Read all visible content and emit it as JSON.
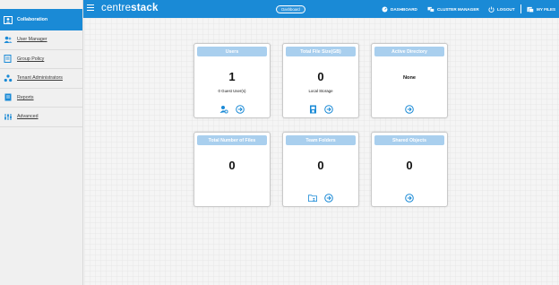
{
  "app": {
    "logo_light": "centre",
    "logo_bold": "stack",
    "dashboard_pill": "Dashboard"
  },
  "header_nav": [
    {
      "label": "DASHBOARD",
      "icon": "dashboard-icon"
    },
    {
      "label": "CLUSTER MANAGER",
      "icon": "cluster-manager-icon"
    },
    {
      "label": "LOGOUT",
      "icon": "logout-icon"
    },
    {
      "label": "MY FILES",
      "icon": "my-files-icon"
    }
  ],
  "sidebar": {
    "items": [
      {
        "label": "Collaboration",
        "icon": "collaboration-icon",
        "active": true
      },
      {
        "label": "User Manager",
        "icon": "user-manager-icon"
      },
      {
        "label": "Group Policy",
        "icon": "group-policy-icon"
      },
      {
        "label": "Tenant Administrators",
        "icon": "tenant-administrators-icon"
      },
      {
        "label": "Reports",
        "icon": "reports-icon"
      },
      {
        "label": "Advanced",
        "icon": "advanced-icon"
      }
    ]
  },
  "cards": [
    {
      "title": "Users",
      "value": "1",
      "sub": "0 Guest User(s)",
      "icons": [
        "user-settings-icon",
        "arrow-right-circle-icon"
      ]
    },
    {
      "title": "Total File Size(GB)",
      "value": "0",
      "sub": "Local Storage",
      "icons": [
        "storage-icon",
        "arrow-right-circle-icon"
      ]
    },
    {
      "title": "Active Directory",
      "value": "None",
      "sub": "",
      "icons": [
        "arrow-right-circle-icon"
      ]
    },
    {
      "title": "Total Number of Files",
      "value": "0",
      "sub": "",
      "icons": []
    },
    {
      "title": "Team Folders",
      "value": "0",
      "sub": "",
      "icons": [
        "team-folder-icon",
        "arrow-right-circle-icon"
      ]
    },
    {
      "title": "Shared Objects",
      "value": "0",
      "sub": "",
      "icons": [
        "arrow-right-circle-icon"
      ]
    }
  ],
  "colors": {
    "brand": "#1a8ad6",
    "card_header": "#a9cfee",
    "icon_blue": "#1a8ad6"
  }
}
